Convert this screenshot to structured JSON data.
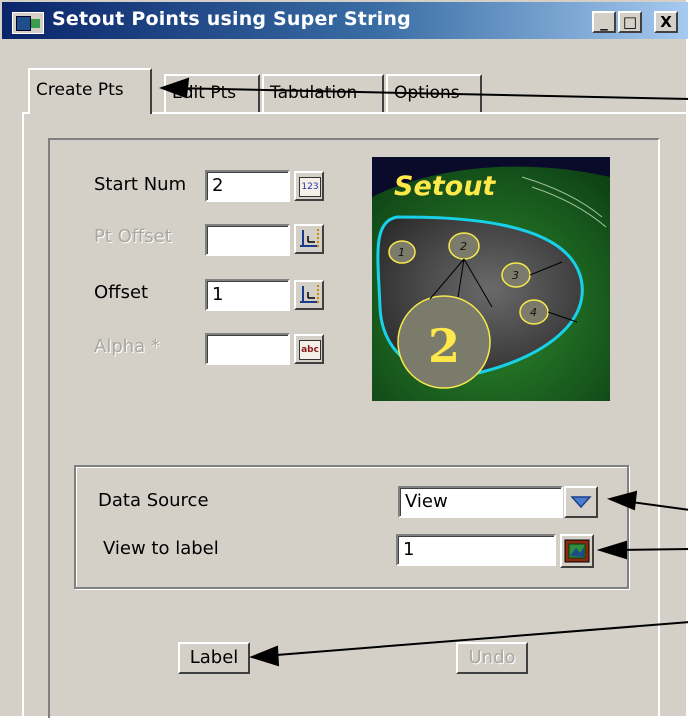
{
  "window": {
    "title": "Setout Points using Super String",
    "minimize": "_",
    "maximize": "□",
    "close": "X"
  },
  "tabs": [
    {
      "label": "Create Pts",
      "active": true
    },
    {
      "label": "Edit Pts",
      "active": false
    },
    {
      "label": "Tabulation",
      "active": false
    },
    {
      "label": "Options",
      "active": false
    }
  ],
  "fields": {
    "start_num": {
      "label": "Start Num",
      "value": "2",
      "button": "123"
    },
    "pt_offset": {
      "label": "Pt Offset",
      "value": ""
    },
    "offset": {
      "label": "Offset",
      "value": "1"
    },
    "alpha": {
      "label": "Alpha *",
      "value": "",
      "button": "abc"
    }
  },
  "preview": {
    "title": "Setout",
    "big_number": "2",
    "small_numbers": [
      "1",
      "2",
      "3",
      "4"
    ]
  },
  "data_source": {
    "label": "Data Source",
    "value": "View"
  },
  "view_to_label": {
    "label": "View to label",
    "value": "1"
  },
  "buttons": {
    "label": "Label",
    "undo": "Undo"
  },
  "colors": {
    "titlebar_start": "#0a246a",
    "titlebar_end": "#a6caf0",
    "face": "#d4d0c8"
  }
}
